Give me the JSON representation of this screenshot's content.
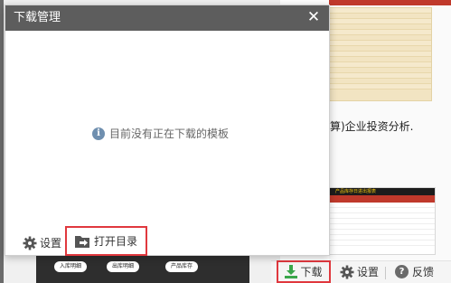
{
  "dialog": {
    "title": "下载管理",
    "close_symbol": "✕",
    "empty_message": "目前没有正在下载的模板",
    "settings_label": "设置",
    "open_directory_label": "打开目录"
  },
  "background": {
    "article_text": "算)企业投资分析.",
    "pills": [
      "入库明细",
      "出库明细",
      "产品库存"
    ],
    "sheet_title": "产品库存日进出报表"
  },
  "toolbar": {
    "download_label": "下载",
    "settings_label": "设置",
    "feedback_label": "反馈"
  },
  "icons": {
    "info": "info-icon",
    "gear": "gear-icon",
    "folder": "folder-open-icon",
    "download": "download-icon",
    "help": "help-icon"
  },
  "colors": {
    "dialog_header": "#5d5d5d",
    "highlight_border": "#e0383e",
    "download_green": "#3aa64a"
  }
}
